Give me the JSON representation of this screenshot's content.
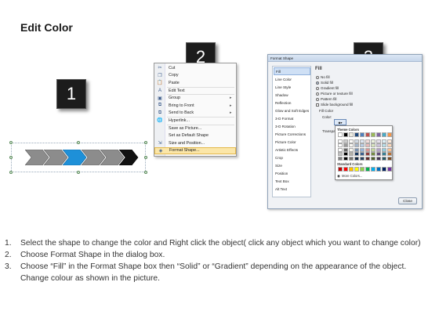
{
  "title": "Edit Color",
  "badges": [
    "1",
    "2",
    "3"
  ],
  "colors": {
    "shape_gray": "#8c8c8c",
    "shape_blue": "#1e90d8",
    "shape_black": "#111111",
    "highlight": "#fbe6a8"
  },
  "context_menu": {
    "items": [
      {
        "label": "Cut",
        "icon": "scissors-icon",
        "submenu": false
      },
      {
        "label": "Copy",
        "icon": "copy-icon",
        "submenu": false
      },
      {
        "label": "Paste",
        "icon": "paste-icon",
        "submenu": false
      },
      {
        "label": "Edit Text",
        "icon": "edit-text-icon",
        "submenu": false
      },
      {
        "label": "Group",
        "icon": "group-icon",
        "submenu": true
      },
      {
        "label": "Bring to Front",
        "icon": "bring-front-icon",
        "submenu": true
      },
      {
        "label": "Send to Back",
        "icon": "send-back-icon",
        "submenu": true
      },
      {
        "label": "Hyperlink...",
        "icon": "hyperlink-icon",
        "submenu": false
      },
      {
        "label": "Save as Picture...",
        "icon": "",
        "submenu": false
      },
      {
        "label": "Set as Default Shape",
        "icon": "",
        "submenu": false
      },
      {
        "label": "Size and Position...",
        "icon": "size-position-icon",
        "submenu": false
      },
      {
        "label": "Format Shape...",
        "icon": "format-shape-icon",
        "submenu": false
      }
    ]
  },
  "dialog": {
    "title": "Format Shape",
    "categories": [
      "Fill",
      "Line Color",
      "Line Style",
      "Shadow",
      "Reflection",
      "Glow and Soft Edges",
      "3-D Format",
      "3-D Rotation",
      "Picture Corrections",
      "Picture Color",
      "Artistic Effects",
      "Crop",
      "Size",
      "Position",
      "Text Box",
      "Alt Text"
    ],
    "selected_category": "Fill",
    "panel_title": "Fill",
    "fill_options": [
      "No fill",
      "Solid fill",
      "Gradient fill",
      "Picture or texture fill",
      "Pattern fill",
      "Slide background fill"
    ],
    "selected_fill": "Solid fill",
    "fill_color_label": "Fill Color",
    "color_label": "Color:",
    "transparency_label": "Transpa",
    "close_label": "Close"
  },
  "palette": {
    "theme_colors_label": "Theme Colors",
    "standard_colors_label": "Standard Colors",
    "more_colors_label": "More Colors...",
    "theme_top": [
      "#ffffff",
      "#000000",
      "#eeece1",
      "#1f497d",
      "#4f81bd",
      "#c0504d",
      "#9bbb59",
      "#8064a2",
      "#4bacc6",
      "#f79646"
    ],
    "standard": [
      "#c00000",
      "#ff0000",
      "#ffc000",
      "#ffff00",
      "#92d050",
      "#00b050",
      "#00b0f0",
      "#0070c0",
      "#002060",
      "#7030a0"
    ]
  },
  "instructions": [
    {
      "num": "1.",
      "text": "Select the shape to change the color and Right click the object( click any object which you want to change color)"
    },
    {
      "num": "2.",
      "text": "Choose Format Shape in the dialog box."
    },
    {
      "num": "3.",
      "text": "Choose “Fill” in the Format Shape box then “Solid” or “Gradient” depending on the appearance of the object. Change colour as shown in the picture."
    }
  ]
}
